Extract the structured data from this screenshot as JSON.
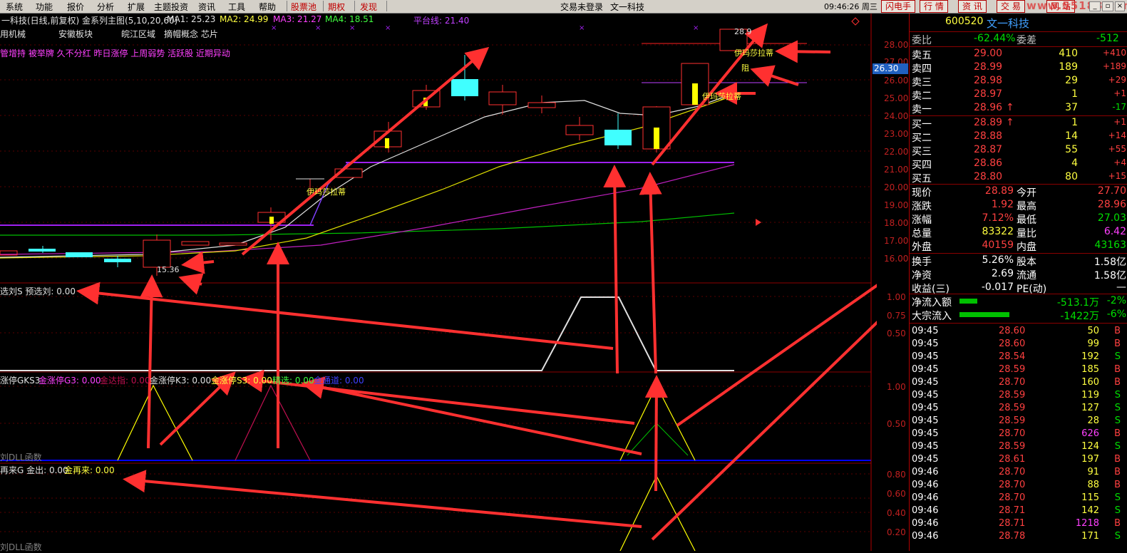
{
  "menubar": {
    "items": [
      "系统",
      "功能",
      "报价",
      "分析",
      "扩展",
      "主题投资",
      "资讯",
      "工具",
      "帮助"
    ],
    "red_items": [
      "股票池",
      "期权",
      "发现"
    ],
    "login_status": "交易未登录",
    "stock_title": "文一科技",
    "clock": "09:46:26 周三",
    "right_buttons": [
      "闪电手",
      "行",
      "情",
      "资",
      "讯",
      "交",
      "易",
      "网",
      "站"
    ],
    "watermark": "www.55188.com"
  },
  "chart": {
    "title_prefix": "一科技(日线,前复权)",
    "indicator_name": "金系列主图(5,10,20,60)",
    "ma1": "MA1: 25.23",
    "ma2": "MA2: 24.99",
    "ma3": "MA3: 21.27",
    "ma4": "MA4: 18.51",
    "platform": "平台线: 21.40",
    "tags_row1": [
      "用机械",
      "安徽板块",
      "皖江区域",
      "摘帽概念 芯片"
    ],
    "tags_row2": "管增持 被举牌 久不分红 昨日涨停 上周弱势 活跃股 近期异动",
    "price_tag": "26.30",
    "low_label": "15.36",
    "high_label": "28.9",
    "annotations": [
      "伊玛莎拉蒂",
      "伊玛莎拉蒂",
      "伊玛莎拉蒂",
      "阻"
    ],
    "sub1_label": "选刘S 预选刘: 0.00",
    "sub2_labels": [
      "涨停GKS3",
      "金涨停G3: 0.00",
      "金达指: 0.00",
      "金涨停K3: 0.00",
      "金涨停S3: 0.00",
      "精选: 0.00",
      "金通道: 0.00"
    ],
    "sub2_footer": "刘DLL函数",
    "sub3_labels": [
      "再来G 金出: 0.00",
      "金再来: 0.00"
    ],
    "sub3_footer": "刘DLL函数",
    "y_main": [
      "28.00",
      "27.00",
      "26.00",
      "25.00",
      "24.00",
      "23.00",
      "22.00",
      "21.00",
      "20.00",
      "19.00",
      "18.00",
      "17.00",
      "16.00"
    ],
    "y_sub1": [
      "1.00",
      "0.75",
      "0.50"
    ],
    "y_sub2": [
      "1.00",
      "0.50"
    ],
    "y_sub3": [
      "0.80",
      "0.60",
      "0.40",
      "0.20"
    ]
  },
  "quote": {
    "code": "600520",
    "name": "文一科技",
    "weibi_label": "委比",
    "weibi": "-62.44%",
    "weicha_label": "委差",
    "weicha": "-512",
    "asks": [
      {
        "label": "卖五",
        "price": "29.00",
        "vol": "410",
        "chg": "+410"
      },
      {
        "label": "卖四",
        "price": "28.99",
        "vol": "189",
        "chg": "+189"
      },
      {
        "label": "卖三",
        "price": "28.98",
        "vol": "29",
        "chg": "+29"
      },
      {
        "label": "卖二",
        "price": "28.97",
        "vol": "1",
        "chg": "+1"
      },
      {
        "label": "卖一",
        "price": "28.96",
        "vol": "37",
        "chg": "-17",
        "arrow": "↑"
      }
    ],
    "bids": [
      {
        "label": "买一",
        "price": "28.89",
        "vol": "1",
        "chg": "+1",
        "arrow": "↑"
      },
      {
        "label": "买二",
        "price": "28.88",
        "vol": "14",
        "chg": "+14"
      },
      {
        "label": "买三",
        "price": "28.87",
        "vol": "55",
        "chg": "+55"
      },
      {
        "label": "买四",
        "price": "28.86",
        "vol": "4",
        "chg": "+4"
      },
      {
        "label": "买五",
        "price": "28.80",
        "vol": "80",
        "chg": "+15"
      }
    ],
    "stats": [
      {
        "l1": "现价",
        "v1": "28.89",
        "l2": "今开",
        "v2": "27.70"
      },
      {
        "l1": "涨跌",
        "v1": "1.92",
        "l2": "最高",
        "v2": "28.96"
      },
      {
        "l1": "涨幅",
        "v1": "7.12%",
        "l2": "最低",
        "v2": "27.03"
      },
      {
        "l1": "总量",
        "v1": "83322",
        "l2": "量比",
        "v2": "6.42"
      },
      {
        "l1": "外盘",
        "v1": "40159",
        "l2": "内盘",
        "v2": "43163"
      }
    ],
    "stats2": [
      {
        "l1": "换手",
        "v1": "5.26%",
        "l2": "股本",
        "v2": "1.58亿"
      },
      {
        "l1": "净资",
        "v1": "2.69",
        "l2": "流通",
        "v2": "1.58亿"
      },
      {
        "l1": "收益(三)",
        "v1": "-0.017",
        "l2": "PE(动)",
        "v2": "—"
      }
    ],
    "flows": [
      {
        "label": "净流入额",
        "value": "-513.1万",
        "pct": "-2%",
        "bar": 0.18
      },
      {
        "label": "大宗流入",
        "value": "-1422万",
        "pct": "-6%",
        "bar": 0.5
      }
    ],
    "ticks": [
      {
        "t": "09:45",
        "p": "28.60",
        "v": "50",
        "s": "B"
      },
      {
        "t": "09:45",
        "p": "28.60",
        "v": "99",
        "s": "B"
      },
      {
        "t": "09:45",
        "p": "28.54",
        "v": "192",
        "s": "S"
      },
      {
        "t": "09:45",
        "p": "28.59",
        "v": "185",
        "s": "B"
      },
      {
        "t": "09:45",
        "p": "28.70",
        "v": "160",
        "s": "B"
      },
      {
        "t": "09:45",
        "p": "28.59",
        "v": "119",
        "s": "S"
      },
      {
        "t": "09:45",
        "p": "28.59",
        "v": "127",
        "s": "S"
      },
      {
        "t": "09:45",
        "p": "28.59",
        "v": "28",
        "s": "S"
      },
      {
        "t": "09:45",
        "p": "28.70",
        "v": "626",
        "s": "B"
      },
      {
        "t": "09:45",
        "p": "28.59",
        "v": "124",
        "s": "S"
      },
      {
        "t": "09:45",
        "p": "28.61",
        "v": "197",
        "s": "B"
      },
      {
        "t": "09:46",
        "p": "28.70",
        "v": "91",
        "s": "B"
      },
      {
        "t": "09:46",
        "p": "28.70",
        "v": "88",
        "s": "B"
      },
      {
        "t": "09:46",
        "p": "28.70",
        "v": "115",
        "s": "S"
      },
      {
        "t": "09:46",
        "p": "28.71",
        "v": "142",
        "s": "S"
      },
      {
        "t": "09:46",
        "p": "28.71",
        "v": "1218",
        "s": "B"
      },
      {
        "t": "09:46",
        "p": "28.78",
        "v": "171",
        "s": "S"
      }
    ]
  }
}
